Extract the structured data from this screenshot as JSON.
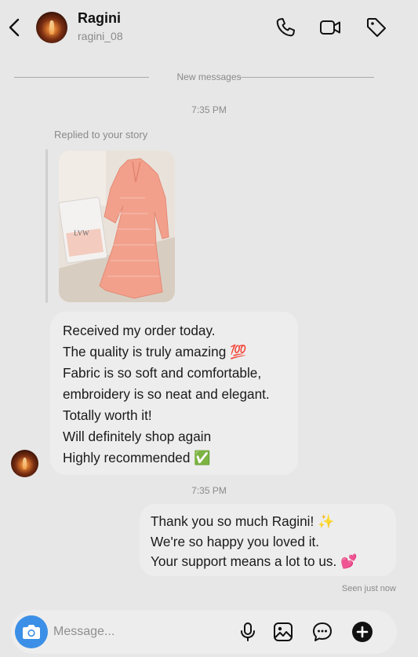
{
  "header": {
    "name": "Ragini",
    "handle": "ragini_08",
    "icons": [
      "back-arrow-icon",
      "phone-icon",
      "video-call-icon",
      "tag-icon"
    ]
  },
  "thread": {
    "new_messages_label": "New messages",
    "time_1": "7:35 PM",
    "replied_label": "Replied to your story",
    "incoming_message": [
      "Received my order today.",
      "The quality is truly amazing 💯",
      "Fabric is so soft and comfortable,",
      "embroidery is so neat and elegant.",
      "Totally worth it!",
      "Will definitely shop again",
      "Highly recommended ✅"
    ],
    "time_2": "7:35 PM",
    "outgoing_message": [
      "Thank you so much Ragini! ✨",
      "We're so happy you loved it.",
      "Your support means a lot to us. 💕"
    ],
    "seen_label": "Seen just now"
  },
  "story": {
    "brand_text": "LVW",
    "dress_color": "#f2a08c"
  },
  "composer": {
    "placeholder": "Message...",
    "icons": [
      "camera-icon",
      "microphone-icon",
      "gallery-icon",
      "sticker-chat-icon",
      "plus-icon"
    ]
  },
  "colors": {
    "background": "#e8e7e7",
    "bubble": "#eeeded",
    "accent_blue": "#3b8fe6",
    "muted_text": "#8a8a8a"
  }
}
